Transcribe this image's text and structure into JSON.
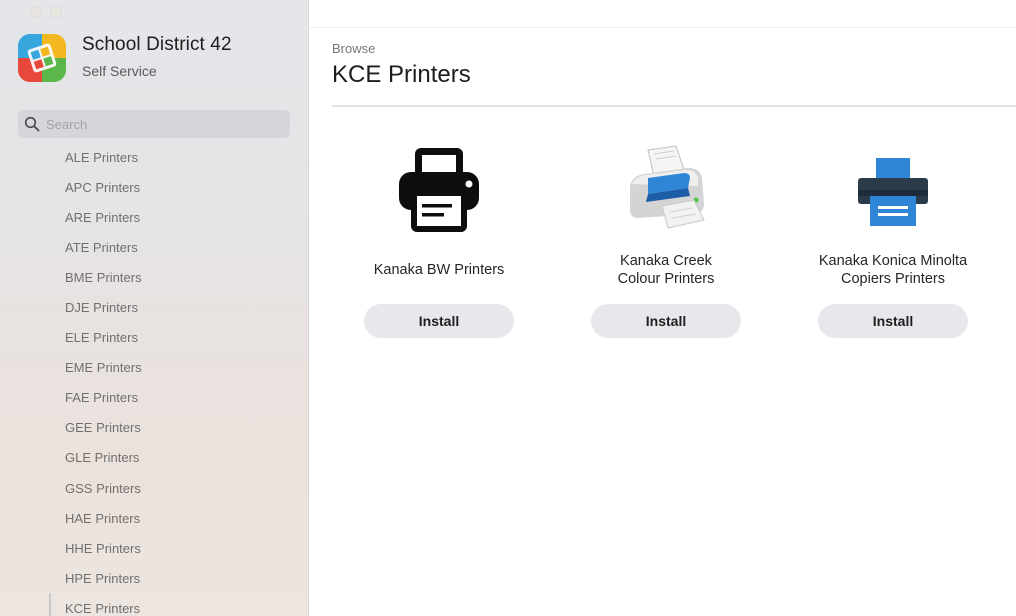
{
  "sidebar": {
    "brand_title": "School District 42",
    "brand_subtitle": "Self Service",
    "search_placeholder": "Search",
    "items": [
      {
        "label": "ALE Printers"
      },
      {
        "label": "APC Printers"
      },
      {
        "label": "ARE Printers"
      },
      {
        "label": "ATE Printers"
      },
      {
        "label": "BME Printers"
      },
      {
        "label": "DJE Printers"
      },
      {
        "label": "ELE Printers"
      },
      {
        "label": "EME Printers"
      },
      {
        "label": "FAE Printers"
      },
      {
        "label": "GEE Printers"
      },
      {
        "label": "GLE Printers"
      },
      {
        "label": "GSS Printers"
      },
      {
        "label": "HAE Printers"
      },
      {
        "label": "HHE Printers"
      },
      {
        "label": "HPE Printers"
      },
      {
        "label": "KCE Printers"
      }
    ],
    "active_item": "KCE Printers"
  },
  "main": {
    "breadcrumb": "Browse",
    "title": "KCE Printers",
    "items": [
      {
        "name": "Kanaka BW Printers",
        "icon": "printer-black-icon",
        "button": "Install"
      },
      {
        "name": "Kanaka Creek\nColour Printers",
        "icon": "printer-color-icon",
        "button": "Install"
      },
      {
        "name": "Kanaka Konica Minolta\nCopiers Printers",
        "icon": "printer-blue-icon",
        "button": "Install"
      }
    ]
  },
  "colors": {
    "accent_blue": "#2f86d6",
    "button_bg": "#e6e8eb",
    "sidebar_bg": "#e6e4e4"
  }
}
